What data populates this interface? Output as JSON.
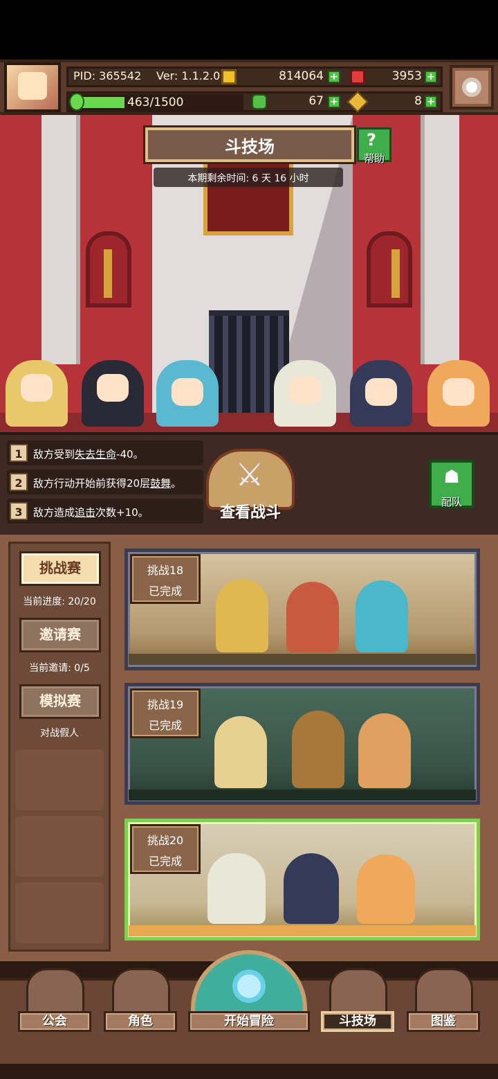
{
  "header": {
    "pid": "PID: 365542",
    "version": "Ver: 1.1.2.0",
    "coins": "814064",
    "gems": "3953",
    "energy": "463/1500",
    "energy_fraction": 0.31,
    "clovers": "67",
    "keys": "8",
    "plus": "+"
  },
  "arena": {
    "title": "斗技场",
    "help_label": "帮助",
    "help_glyph": "?",
    "remaining_time": "本期剩余时间: 6 天 16 小时"
  },
  "buffs": [
    {
      "num": "1",
      "pre": "敌方受到",
      "key": "失去生命",
      "post": "-40。"
    },
    {
      "num": "2",
      "pre": "敌方行动开始前获得20层",
      "key": "鼓舞",
      "post": "。"
    },
    {
      "num": "3",
      "pre": "敌方造成",
      "key": "追击",
      "post": "次数+10。"
    }
  ],
  "battle": {
    "view_label": "查看战斗",
    "team_label": "配队"
  },
  "modes": [
    {
      "label": "挑战赛",
      "sub": "当前进度: 20/20"
    },
    {
      "label": "邀请赛",
      "sub": "当前邀请: 0/5"
    },
    {
      "label": "模拟赛",
      "sub": "对战假人"
    }
  ],
  "challenges": [
    {
      "title": "挑战18",
      "status": "已完成"
    },
    {
      "title": "挑战19",
      "status": "已完成"
    },
    {
      "title": "挑战20",
      "status": "已完成"
    }
  ],
  "nav": {
    "guild": "公会",
    "characters": "角色",
    "start": "开始冒险",
    "arena": "斗技场",
    "codex": "图鉴"
  },
  "icons": {
    "settings": "gear-icon",
    "coin": "coin-icon",
    "gem": "gem-icon",
    "energy": "energy-icon",
    "clover": "clover-icon",
    "key": "key-icon",
    "swords": "crossed-swords-icon",
    "team": "team-icon"
  },
  "colors": {
    "accent_green": "#3fae4a",
    "panel_brown": "#8a5e46",
    "arena_red": "#b7333a"
  }
}
